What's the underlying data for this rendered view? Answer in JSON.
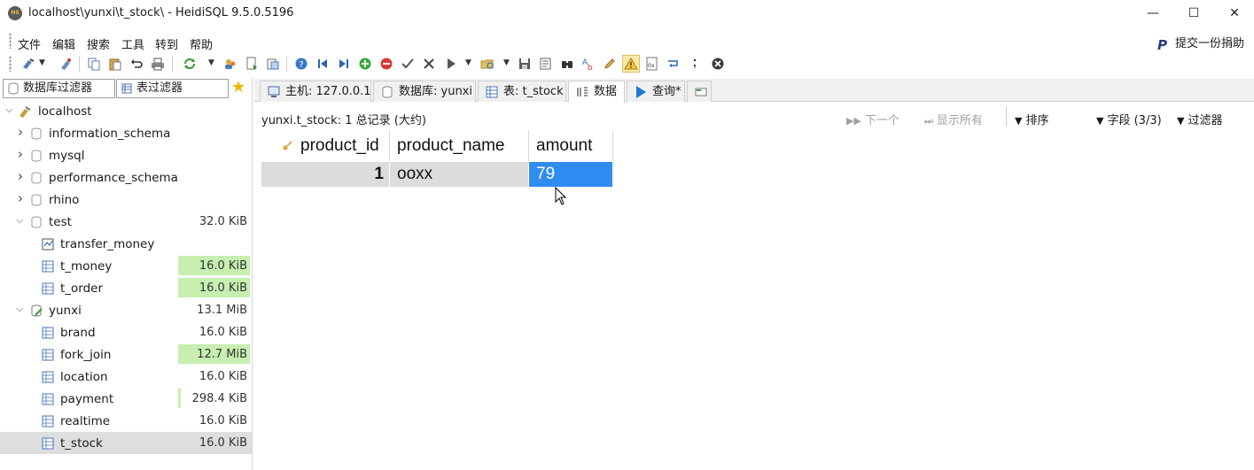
{
  "window": {
    "title": "localhost\\yunxi\\t_stock\\ - HeidiSQL 9.5.0.5196",
    "app_icon_text": "HS",
    "minimize": "—",
    "maximize": "☐",
    "close": "✕"
  },
  "menu": {
    "items": [
      "文件",
      "编辑",
      "搜索",
      "工具",
      "转到",
      "帮助"
    ],
    "donate_label": "提交一份捐助",
    "donate_icon": "P"
  },
  "left_panel": {
    "db_filter_placeholder": "数据库过滤器",
    "table_filter_placeholder": "表过滤器",
    "root": "localhost",
    "tree": [
      {
        "label": "information_schema",
        "size": "",
        "level": 1,
        "expanded": false,
        "kind": "database"
      },
      {
        "label": "mysql",
        "size": "",
        "level": 1,
        "expanded": false,
        "kind": "database"
      },
      {
        "label": "performance_schema",
        "size": "",
        "level": 1,
        "expanded": false,
        "kind": "database"
      },
      {
        "label": "rhino",
        "size": "",
        "level": 1,
        "expanded": false,
        "kind": "database"
      },
      {
        "label": "test",
        "size": "32.0 KiB",
        "level": 1,
        "expanded": true,
        "kind": "database"
      },
      {
        "label": "transfer_money",
        "size": "",
        "level": 2,
        "kind": "procedure"
      },
      {
        "label": "t_money",
        "size": "16.0 KiB",
        "level": 2,
        "kind": "table",
        "size_fraction": 1.0
      },
      {
        "label": "t_order",
        "size": "16.0 KiB",
        "level": 2,
        "kind": "table",
        "size_fraction": 1.0
      },
      {
        "label": "yunxi",
        "size": "13.1 MiB",
        "level": 1,
        "expanded": true,
        "kind": "database-active"
      },
      {
        "label": "brand",
        "size": "16.0 KiB",
        "level": 2,
        "kind": "table",
        "size_fraction": 0.0
      },
      {
        "label": "fork_join",
        "size": "12.7 MiB",
        "level": 2,
        "kind": "table",
        "size_fraction": 1.0
      },
      {
        "label": "location",
        "size": "16.0 KiB",
        "level": 2,
        "kind": "table",
        "size_fraction": 0.0
      },
      {
        "label": "payment",
        "size": "298.4 KiB",
        "level": 2,
        "kind": "table",
        "size_fraction": 0.02
      },
      {
        "label": "realtime",
        "size": "16.0 KiB",
        "level": 2,
        "kind": "table",
        "size_fraction": 0.0
      },
      {
        "label": "t_stock",
        "size": "16.0 KiB",
        "level": 2,
        "kind": "table",
        "size_fraction": 0.0,
        "selected": true
      }
    ]
  },
  "tabs": [
    {
      "label": "主机: 127.0.0.1",
      "icon": "host-icon"
    },
    {
      "label": "数据库: yunxi",
      "icon": "database-icon"
    },
    {
      "label": "表: t_stock",
      "icon": "table-icon"
    },
    {
      "label": "数据",
      "icon": "data-icon",
      "active": true
    },
    {
      "label": "查询*",
      "icon": "run-icon"
    },
    {
      "label": "",
      "icon": "new-query-tab-icon"
    }
  ],
  "infobar": {
    "text": "yunxi.t_stock: 1 总记录 (大约)",
    "next_label": "下一个",
    "show_all_label": "显示所有",
    "sort_label": "排序",
    "columns_label": "字段 (3/3)",
    "filter_label": "过滤器"
  },
  "grid": {
    "columns": [
      "product_id",
      "product_name",
      "amount"
    ],
    "key_column_icon": "primary-key-icon",
    "rows": [
      [
        "1",
        "ooxx",
        "79"
      ]
    ],
    "focused_cell": {
      "row": 0,
      "column": "amount"
    }
  },
  "colors": {
    "accent_selection": "#2f8cf0",
    "size_bar": "#c6efb0",
    "row_background": "#dcdcdc"
  }
}
